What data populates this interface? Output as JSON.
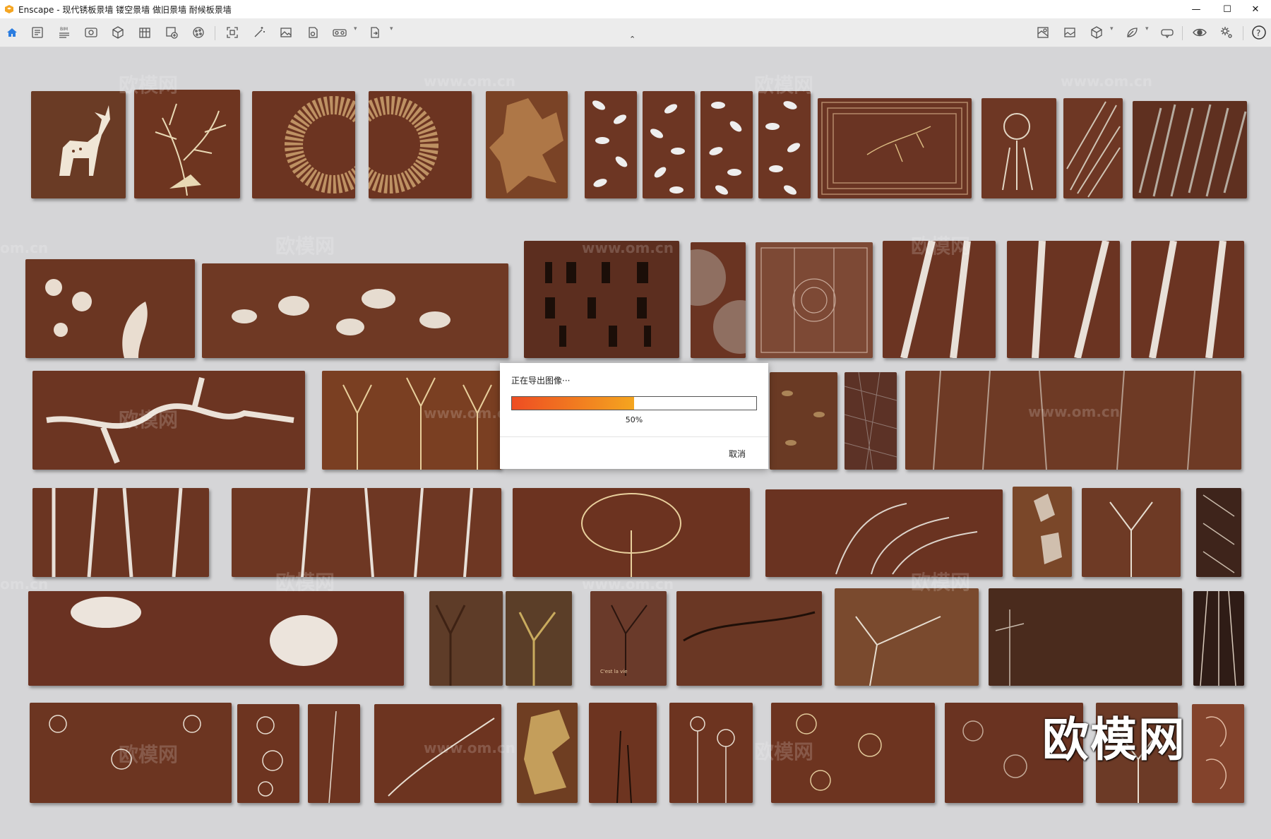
{
  "window": {
    "title": "Enscape - 现代锈板景墙 镂空景墙 做旧景墙 耐候板景墙",
    "minimize": "—",
    "maximize": "☐",
    "close": "✕"
  },
  "toolbar": {
    "left_icons": [
      "home-icon",
      "document-icon",
      "bim-icon",
      "eye-icon",
      "cube-view-icon",
      "asset-library-icon",
      "add-asset-icon",
      "material-icon",
      "screenshot-icon",
      "magic-icon",
      "image-icon",
      "batch-icon",
      "vr-icon",
      "export-icon"
    ],
    "right_icons": [
      "map-icon",
      "gallery-icon",
      "box-icon",
      "leaf-icon",
      "headset-icon",
      "visibility-icon",
      "settings-icon",
      "help-icon"
    ],
    "collapse": "⌃",
    "bim_label": "BIM",
    "help_label": "?"
  },
  "viewport": {
    "watermarks": [
      "欧模网",
      "www.om.cn",
      "欧模网",
      "www.om.cn",
      "欧模网",
      "www.om.cn",
      "om.cn",
      "欧模网",
      "www.om.cn",
      "欧模网",
      "www.om.cn",
      "欧模网",
      "om.cn",
      "欧模网",
      "www.om.cn",
      "欧模网",
      "欧模网",
      "www.om.cn"
    ],
    "big_watermark": "欧模网",
    "panel_text": "C'est la vie"
  },
  "dialog": {
    "title": "正在导出图像···",
    "progress": 0.5,
    "percent_label": "50%",
    "cancel_label": "取消",
    "colors": {
      "start": "#ee4d22",
      "end": "#f4a51f"
    }
  }
}
